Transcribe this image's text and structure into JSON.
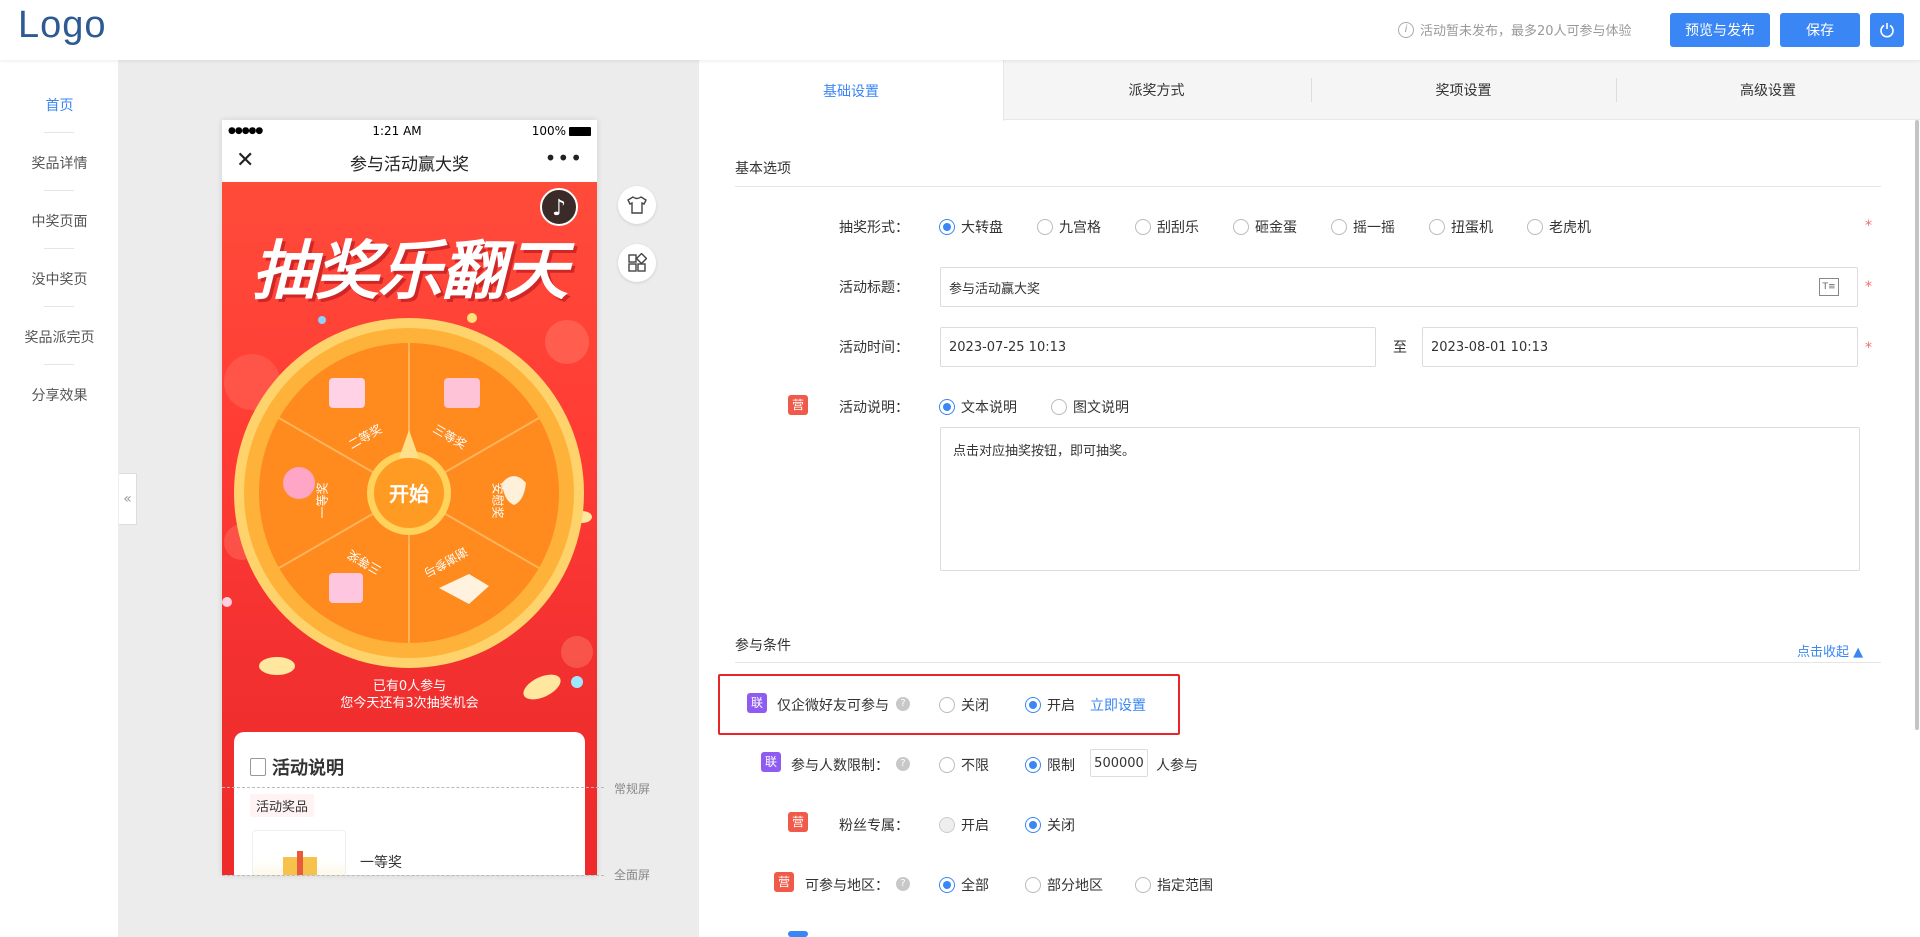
{
  "header": {
    "logo": "Logo",
    "publish_tip": "活动暂未发布，最多20人可参与体验",
    "preview_publish_label": "预览与发布",
    "save_label": "保存"
  },
  "sidebar": {
    "items": [
      {
        "label": "首页",
        "active": true
      },
      {
        "label": "奖品详情"
      },
      {
        "label": "中奖页面"
      },
      {
        "label": "没中奖页"
      },
      {
        "label": "奖品派完页"
      },
      {
        "label": "分享效果"
      }
    ],
    "collapse_glyph": "«"
  },
  "phone": {
    "signal": "●●●●●",
    "time": "1:21 AM",
    "battery": "100%",
    "nav_title": "参与活动赢大奖",
    "hero_title": "抽奖乐翻天",
    "start_label": "开始",
    "wheel_prizes": [
      "二等奖",
      "三等奖",
      "安慰奖",
      "谢谢参与",
      "三等奖",
      "一等奖"
    ],
    "joined_line1": "已有0人参与",
    "joined_line2": "您今天还有3次抽奖机会",
    "section_title": "活动说明",
    "prize_tag": "活动奖品",
    "prize_name": "一等奖"
  },
  "screen_labels": {
    "normal": "常规屏",
    "full": "全面屏"
  },
  "tabs": [
    {
      "label": "基础设置",
      "active": true
    },
    {
      "label": "派奖方式"
    },
    {
      "label": "奖项设置"
    },
    {
      "label": "高级设置"
    }
  ],
  "basic": {
    "section_title": "基本选项",
    "form_label": "抽奖形式：",
    "form_options": [
      "大转盘",
      "九宫格",
      "刮刮乐",
      "砸金蛋",
      "摇一摇",
      "扭蛋机",
      "老虎机"
    ],
    "form_selected": "大转盘",
    "title_label": "活动标题：",
    "title_value": "参与活动赢大奖",
    "time_label": "活动时间：",
    "time_start": "2023-07-25 10:13",
    "time_sep": "至",
    "time_end": "2023-08-01 10:13",
    "desc_badge": "营",
    "desc_label": "活动说明：",
    "desc_options": [
      "文本说明",
      "图文说明"
    ],
    "desc_selected": "文本说明",
    "desc_text": "点击对应抽奖按钮，即可抽奖。",
    "required_mark": "*"
  },
  "conditions": {
    "section_title": "参与条件",
    "collapse_link": "点击收起 ▲",
    "wecom": {
      "badge": "联",
      "label": "仅企微好友可参与",
      "options": [
        "关闭",
        "开启"
      ],
      "selected": "开启",
      "link": "立即设置"
    },
    "limit": {
      "badge": "联",
      "label": "参与人数限制：",
      "options": [
        "不限",
        "限制"
      ],
      "selected": "限制",
      "value": "500000",
      "suffix": "人参与"
    },
    "fans": {
      "badge": "营",
      "label": "粉丝专属：",
      "options": [
        "开启",
        "关闭"
      ],
      "selected": "关闭"
    },
    "region": {
      "badge": "营",
      "label": "可参与地区：",
      "options": [
        "全部",
        "部分地区",
        "指定范围"
      ],
      "selected": "全部"
    }
  },
  "colors": {
    "accent": "#3a86f5",
    "highlight_box": "#e8262a",
    "badge_ying": "#f05a4a",
    "badge_lian": "#8e5cf0"
  }
}
